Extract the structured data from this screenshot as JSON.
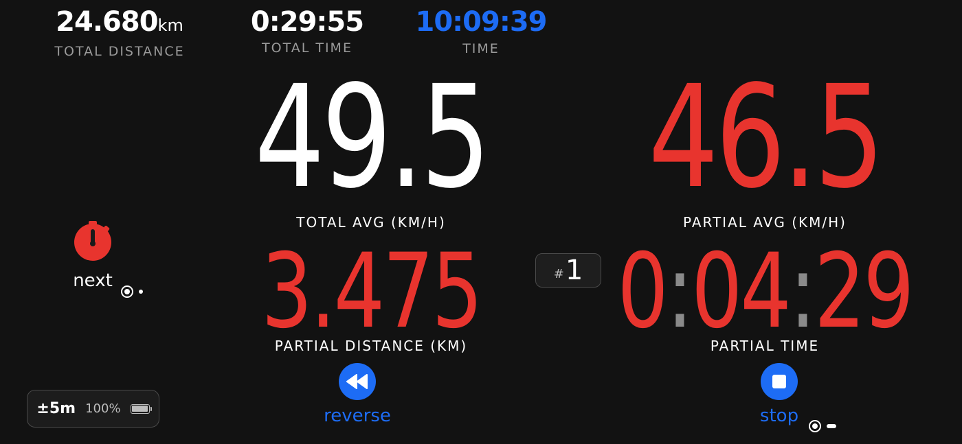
{
  "top": {
    "total_distance": {
      "value": "24.680",
      "unit": "km",
      "label": "TOTAL DISTANCE"
    },
    "total_time": {
      "value": "0:29:55",
      "label": "TOTAL TIME"
    },
    "clock": {
      "value": "10:09:39",
      "label": "TIME"
    }
  },
  "main": {
    "total_avg": {
      "value": "49.5",
      "label": "TOTAL AVG (KM/H)"
    },
    "partial_avg": {
      "value": "46.5",
      "label": "PARTIAL AVG (KM/H)"
    },
    "partial_distance": {
      "value": "3.475",
      "label": "PARTIAL DISTANCE (KM)"
    },
    "partial_time": {
      "h": "0",
      "m": "04",
      "s": "29",
      "sep": ":",
      "label": "PARTIAL TIME"
    }
  },
  "lap": {
    "hash": "#",
    "number": "1"
  },
  "controls": {
    "next": {
      "label": "next",
      "icon": "stopwatch-icon"
    },
    "reverse": {
      "label": "reverse",
      "icon": "rewind-icon"
    },
    "stop": {
      "label": "stop",
      "icon": "stop-icon"
    }
  },
  "status": {
    "gps_accuracy": "±5m",
    "battery_percent": "100%",
    "battery_level": 1.0
  },
  "colors": {
    "background": "#121212",
    "accent_red": "#e8342e",
    "accent_blue": "#1d6cf5",
    "label_gray": "#9a9a9a"
  }
}
